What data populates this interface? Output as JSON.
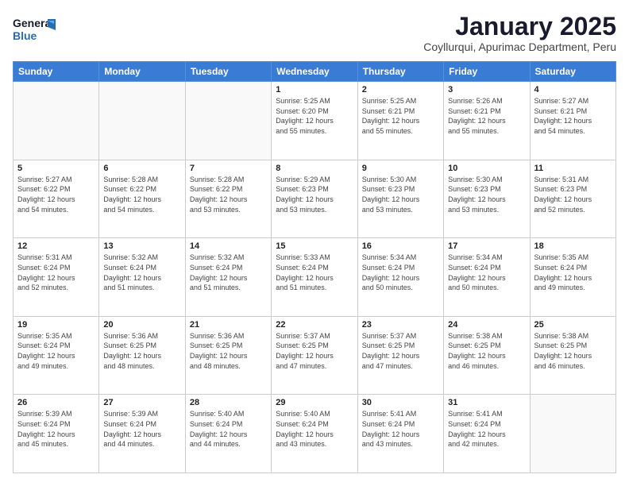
{
  "header": {
    "logo_general": "General",
    "logo_blue": "Blue",
    "month_title": "January 2025",
    "subtitle": "Coyllurqui, Apurimac Department, Peru"
  },
  "days_of_week": [
    "Sunday",
    "Monday",
    "Tuesday",
    "Wednesday",
    "Thursday",
    "Friday",
    "Saturday"
  ],
  "weeks": [
    [
      {
        "day": "",
        "info": ""
      },
      {
        "day": "",
        "info": ""
      },
      {
        "day": "",
        "info": ""
      },
      {
        "day": "1",
        "info": "Sunrise: 5:25 AM\nSunset: 6:20 PM\nDaylight: 12 hours\nand 55 minutes."
      },
      {
        "day": "2",
        "info": "Sunrise: 5:25 AM\nSunset: 6:21 PM\nDaylight: 12 hours\nand 55 minutes."
      },
      {
        "day": "3",
        "info": "Sunrise: 5:26 AM\nSunset: 6:21 PM\nDaylight: 12 hours\nand 55 minutes."
      },
      {
        "day": "4",
        "info": "Sunrise: 5:27 AM\nSunset: 6:21 PM\nDaylight: 12 hours\nand 54 minutes."
      }
    ],
    [
      {
        "day": "5",
        "info": "Sunrise: 5:27 AM\nSunset: 6:22 PM\nDaylight: 12 hours\nand 54 minutes."
      },
      {
        "day": "6",
        "info": "Sunrise: 5:28 AM\nSunset: 6:22 PM\nDaylight: 12 hours\nand 54 minutes."
      },
      {
        "day": "7",
        "info": "Sunrise: 5:28 AM\nSunset: 6:22 PM\nDaylight: 12 hours\nand 53 minutes."
      },
      {
        "day": "8",
        "info": "Sunrise: 5:29 AM\nSunset: 6:23 PM\nDaylight: 12 hours\nand 53 minutes."
      },
      {
        "day": "9",
        "info": "Sunrise: 5:30 AM\nSunset: 6:23 PM\nDaylight: 12 hours\nand 53 minutes."
      },
      {
        "day": "10",
        "info": "Sunrise: 5:30 AM\nSunset: 6:23 PM\nDaylight: 12 hours\nand 53 minutes."
      },
      {
        "day": "11",
        "info": "Sunrise: 5:31 AM\nSunset: 6:23 PM\nDaylight: 12 hours\nand 52 minutes."
      }
    ],
    [
      {
        "day": "12",
        "info": "Sunrise: 5:31 AM\nSunset: 6:24 PM\nDaylight: 12 hours\nand 52 minutes."
      },
      {
        "day": "13",
        "info": "Sunrise: 5:32 AM\nSunset: 6:24 PM\nDaylight: 12 hours\nand 51 minutes."
      },
      {
        "day": "14",
        "info": "Sunrise: 5:32 AM\nSunset: 6:24 PM\nDaylight: 12 hours\nand 51 minutes."
      },
      {
        "day": "15",
        "info": "Sunrise: 5:33 AM\nSunset: 6:24 PM\nDaylight: 12 hours\nand 51 minutes."
      },
      {
        "day": "16",
        "info": "Sunrise: 5:34 AM\nSunset: 6:24 PM\nDaylight: 12 hours\nand 50 minutes."
      },
      {
        "day": "17",
        "info": "Sunrise: 5:34 AM\nSunset: 6:24 PM\nDaylight: 12 hours\nand 50 minutes."
      },
      {
        "day": "18",
        "info": "Sunrise: 5:35 AM\nSunset: 6:24 PM\nDaylight: 12 hours\nand 49 minutes."
      }
    ],
    [
      {
        "day": "19",
        "info": "Sunrise: 5:35 AM\nSunset: 6:24 PM\nDaylight: 12 hours\nand 49 minutes."
      },
      {
        "day": "20",
        "info": "Sunrise: 5:36 AM\nSunset: 6:25 PM\nDaylight: 12 hours\nand 48 minutes."
      },
      {
        "day": "21",
        "info": "Sunrise: 5:36 AM\nSunset: 6:25 PM\nDaylight: 12 hours\nand 48 minutes."
      },
      {
        "day": "22",
        "info": "Sunrise: 5:37 AM\nSunset: 6:25 PM\nDaylight: 12 hours\nand 47 minutes."
      },
      {
        "day": "23",
        "info": "Sunrise: 5:37 AM\nSunset: 6:25 PM\nDaylight: 12 hours\nand 47 minutes."
      },
      {
        "day": "24",
        "info": "Sunrise: 5:38 AM\nSunset: 6:25 PM\nDaylight: 12 hours\nand 46 minutes."
      },
      {
        "day": "25",
        "info": "Sunrise: 5:38 AM\nSunset: 6:25 PM\nDaylight: 12 hours\nand 46 minutes."
      }
    ],
    [
      {
        "day": "26",
        "info": "Sunrise: 5:39 AM\nSunset: 6:24 PM\nDaylight: 12 hours\nand 45 minutes."
      },
      {
        "day": "27",
        "info": "Sunrise: 5:39 AM\nSunset: 6:24 PM\nDaylight: 12 hours\nand 44 minutes."
      },
      {
        "day": "28",
        "info": "Sunrise: 5:40 AM\nSunset: 6:24 PM\nDaylight: 12 hours\nand 44 minutes."
      },
      {
        "day": "29",
        "info": "Sunrise: 5:40 AM\nSunset: 6:24 PM\nDaylight: 12 hours\nand 43 minutes."
      },
      {
        "day": "30",
        "info": "Sunrise: 5:41 AM\nSunset: 6:24 PM\nDaylight: 12 hours\nand 43 minutes."
      },
      {
        "day": "31",
        "info": "Sunrise: 5:41 AM\nSunset: 6:24 PM\nDaylight: 12 hours\nand 42 minutes."
      },
      {
        "day": "",
        "info": ""
      }
    ]
  ]
}
